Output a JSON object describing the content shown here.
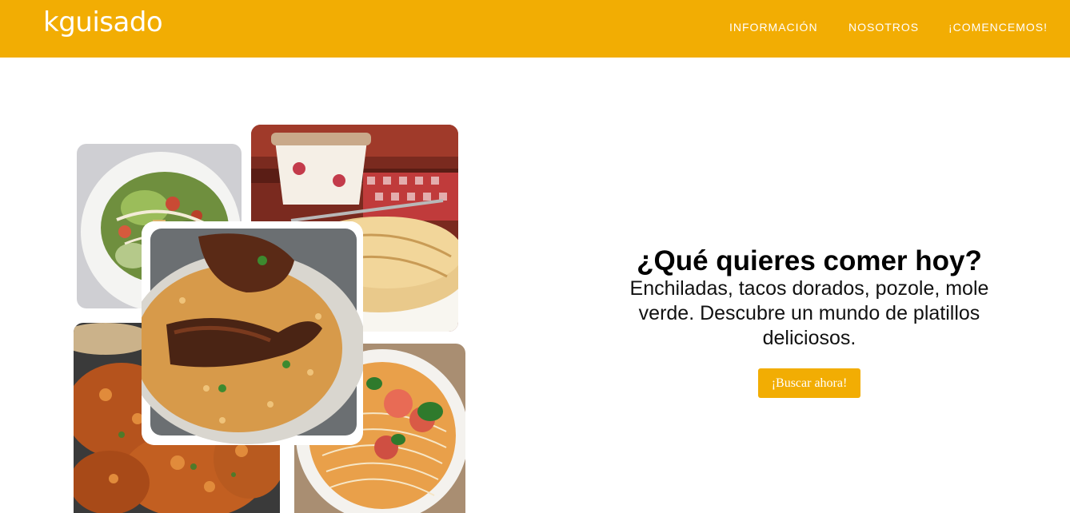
{
  "header": {
    "logo_text": "kguisado",
    "nav": [
      {
        "label": "INFORMACIÓN"
      },
      {
        "label": "NOSOTROS"
      },
      {
        "label": "¡COMENCEMOS!"
      }
    ]
  },
  "hero": {
    "title": "¿Qué quieres comer hoy?",
    "description": "Enchiladas, tacos dorados, pozole, mole verde. Descubre un mundo de platillos deliciosos.",
    "button_label": "¡Buscar ahora!"
  },
  "colors": {
    "brand": "#F2AD03",
    "nav_text": "#FFFFFF",
    "text": "#000000"
  },
  "collage": [
    {
      "name": "salad-photo"
    },
    {
      "name": "crepes-photo"
    },
    {
      "name": "fried-fritters-photo"
    },
    {
      "name": "noodle-soup-photo"
    },
    {
      "name": "chicken-rice-photo"
    }
  ]
}
